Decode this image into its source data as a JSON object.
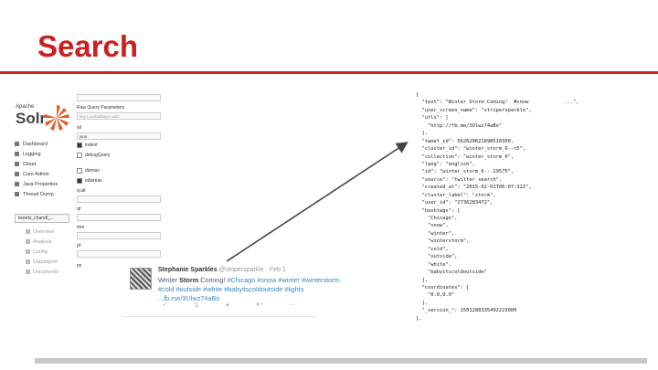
{
  "slide": {
    "title": "Search"
  },
  "solr": {
    "logo_small": "Apache",
    "logo": "Solr",
    "nav": [
      {
        "label": "Dashboard",
        "icon": "dashboard-icon"
      },
      {
        "label": "Logging",
        "icon": "logging-icon"
      },
      {
        "label": "Cloud",
        "icon": "cloud-icon"
      },
      {
        "label": "Core Admin",
        "icon": "core-admin-icon"
      },
      {
        "label": "Java Properties",
        "icon": "java-properties-icon"
      },
      {
        "label": "Thread Dump",
        "icon": "thread-dump-icon"
      }
    ],
    "core_selector": "tweets_chandl_...",
    "core_nav": [
      {
        "label": "Overview",
        "icon": "overview-icon"
      },
      {
        "label": "Analysis",
        "icon": "analysis-icon"
      },
      {
        "label": "Config",
        "icon": "config-icon"
      },
      {
        "label": "Dataimport",
        "icon": "dataimport-icon"
      },
      {
        "label": "Documents",
        "icon": "documents-icon"
      }
    ]
  },
  "query_form": {
    "raw_params_label": "Raw Query Parameters",
    "raw_params_value": "key1=val1&key2=val2",
    "wt_label": "wt",
    "wt_value": "json",
    "indent_label": "indent",
    "debug_label": "debugQuery",
    "dismax_label": "dismax",
    "edismax_label": "edismax",
    "qalt_label": "q.alt",
    "qf_label": "qf",
    "mm_label": "mm",
    "pf_label": "pf",
    "ps_label": "ps"
  },
  "tweet": {
    "name": "Stephanie Sparkles",
    "handle": "@stripersparkle · Feb 1",
    "text_lead": "Winter ",
    "text_bold": "Storm",
    "text_mid": " Coming! ",
    "tags_line1": "#Chicago #snow #winter #winterstorm #cold #outside",
    "tags_line2": "#white #babyitscoldoutside #lights",
    "link": "...fb.me/3Ulwz74aBo"
  },
  "json": {
    "lines": [
      "{",
      "  \"text\": \"Winter Storm Coming!  #snow            ...\",",
      "  \"user_screen_name\": \"stripersparkle\",",
      "  \"urls\": [",
      "    \"http://fb.me/3Ulwz74aBo\"",
      "  ],",
      "  \"tweet_id\": 562620621898510300,",
      "  \"cluster_id\": \"winter_storm_6--c5\",",
      "  \"collection\": \"winter_storm_6\",",
      "  \"lang\": \"english\",",
      "  \"id\": \"winter_storm_6---29575\",",
      "  \"source\": \"twitter search\",",
      "  \"created_at\": \"2015-02-01T06:07:32Z\",",
      "  \"cluster_label\": \"storm\",",
      "  \"user_id\": \"2736283472\",",
      "  \"hashtags\": [",
      "    \"Chicago\",",
      "    \"snow\",",
      "    \"winter\",",
      "    \"winterstorm\",",
      "    \"cold\",",
      "    \"outside\",",
      "    \"white\",",
      "    \"babyitscoldoutside\"",
      "  ],",
      "  \"coordinates\": [",
      "    \"0.0,0.0\"",
      "  ],",
      "  \"_version_\": 1501288335492223000",
      "},"
    ]
  },
  "colors": {
    "accent": "#cc1f1f",
    "tag": "#3b88c3",
    "json_value": "#2e7d32"
  }
}
